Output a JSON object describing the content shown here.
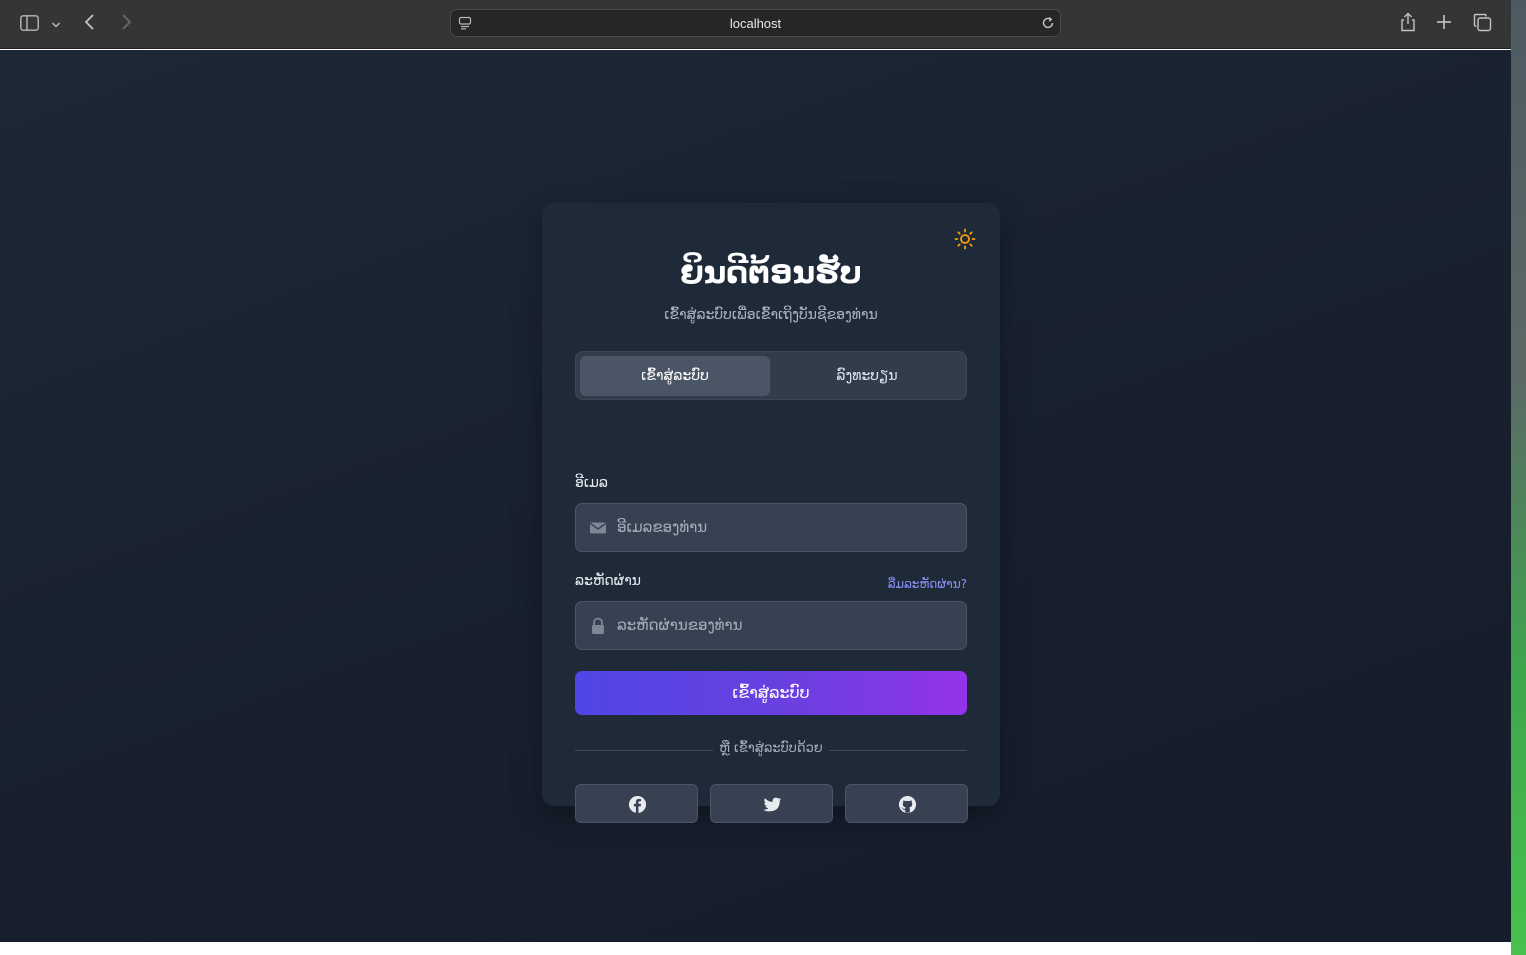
{
  "browser": {
    "url": "localhost",
    "icons": [
      "sidebar-icon",
      "chevron-down-icon",
      "back-icon",
      "forward-icon",
      "site-settings-icon",
      "reload-icon",
      "share-icon",
      "new-tab-icon",
      "tabs-overview-icon"
    ]
  },
  "login": {
    "title": "ຍິນດີຕ້ອນຮັບ",
    "subtitle": "ເຂົ້າສູ່ລະບົບເພື່ອເຂົ້າເຖິງບັນຊີຂອງທ່ານ",
    "tabs": [
      {
        "label": "ເຂົ້າສູ່ລະບົບ",
        "active": true
      },
      {
        "label": "ລົງທະບຽນ",
        "active": false
      }
    ],
    "email": {
      "label": "ອີເມລ",
      "placeholder": "ອີເມລຂອງທ່ານ",
      "icon": "envelope-icon"
    },
    "password": {
      "label": "ລະຫັດຜ່ານ",
      "placeholder": "ລະຫັດຜ່ານຂອງທ່ານ",
      "icon": "lock-icon",
      "forgot_label": "ລືມລະຫັດຜ່ານ?"
    },
    "submit_label": "ເຂົ້າສູ່ລະບົບ",
    "divider_label": "ຫຼື ເຂົ້າສູ່ລະບົບດ້ວຍ",
    "social": [
      "facebook-icon",
      "twitter-icon",
      "github-icon"
    ],
    "theme_icon": "sun-icon"
  },
  "colors": {
    "accent_start": "#4f46e5",
    "accent_end": "#9333ea",
    "link": "#8b93f6",
    "sun": "#f59e0b"
  }
}
